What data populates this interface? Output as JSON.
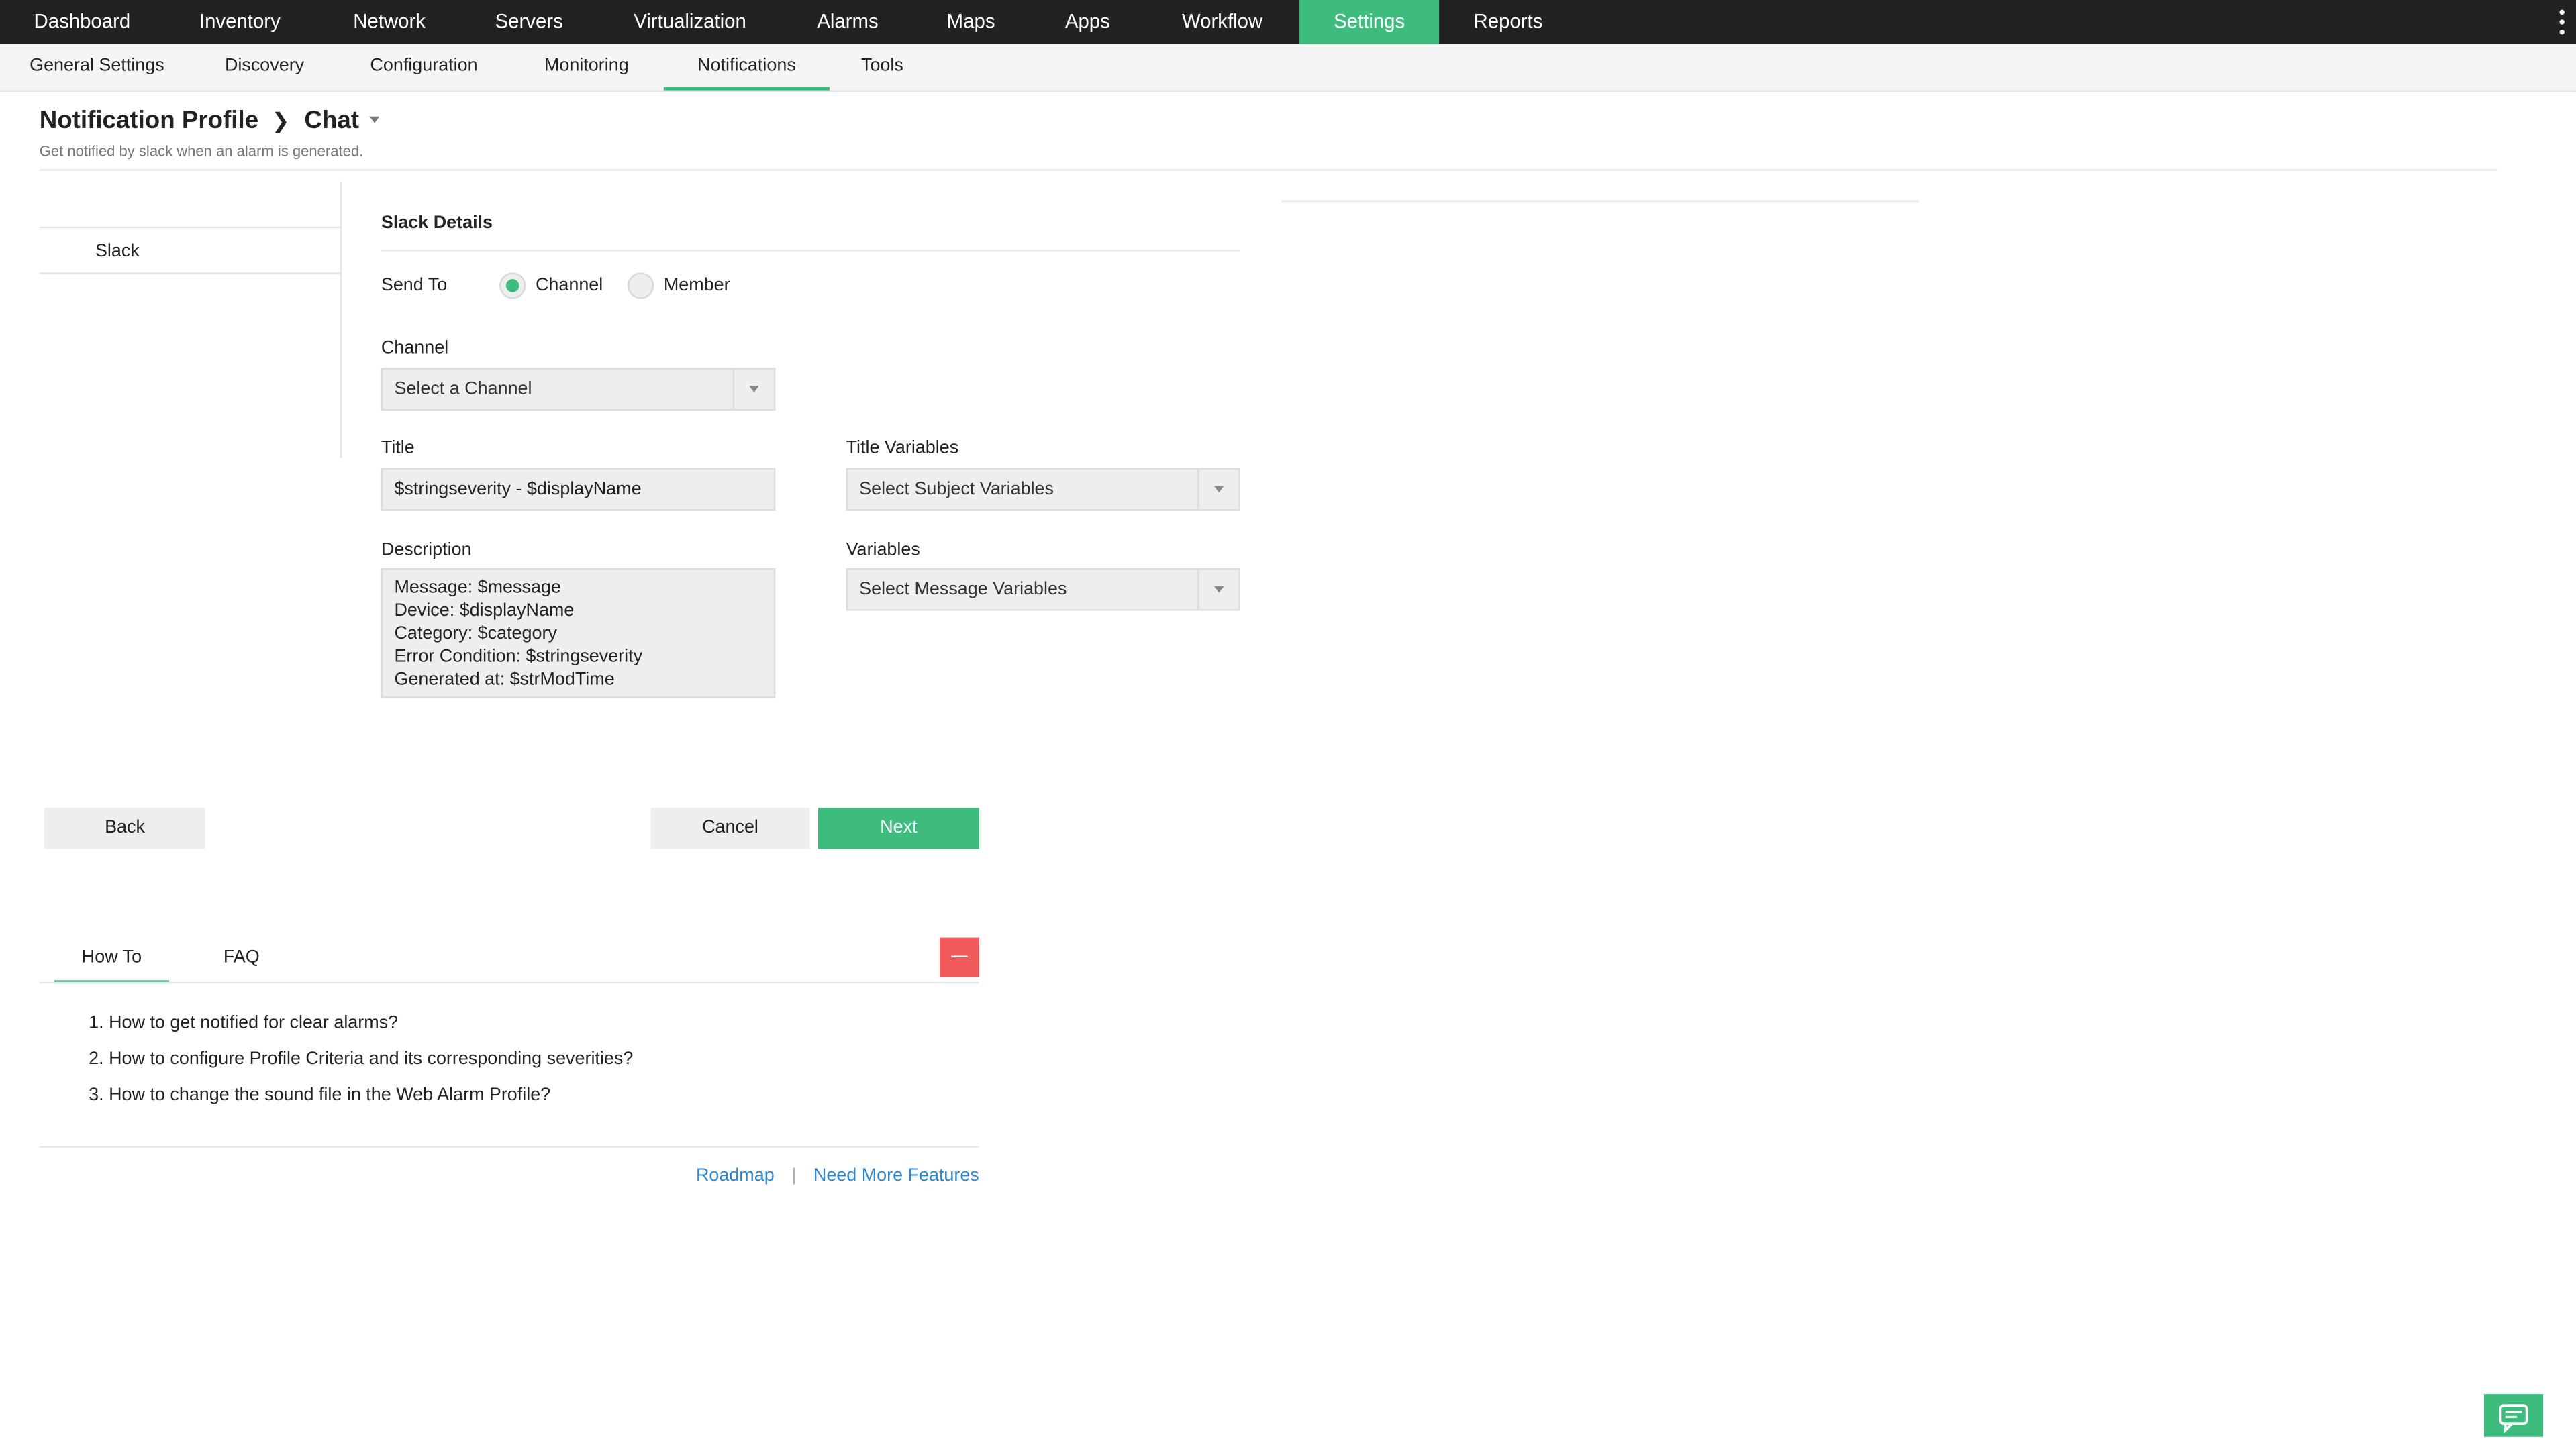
{
  "topnav": {
    "items": [
      {
        "label": "Dashboard"
      },
      {
        "label": "Inventory"
      },
      {
        "label": "Network"
      },
      {
        "label": "Servers"
      },
      {
        "label": "Virtualization"
      },
      {
        "label": "Alarms"
      },
      {
        "label": "Maps"
      },
      {
        "label": "Apps"
      },
      {
        "label": "Workflow"
      },
      {
        "label": "Settings"
      },
      {
        "label": "Reports"
      }
    ],
    "active": "Settings"
  },
  "subnav": {
    "items": [
      {
        "label": "General Settings"
      },
      {
        "label": "Discovery"
      },
      {
        "label": "Configuration"
      },
      {
        "label": "Monitoring"
      },
      {
        "label": "Notifications"
      },
      {
        "label": "Tools"
      }
    ],
    "active": "Notifications"
  },
  "header": {
    "breadcrumb_root": "Notification Profile",
    "breadcrumb_current": "Chat",
    "subtitle": "Get notified by slack when an alarm is generated."
  },
  "left_panel": {
    "tab": "Slack"
  },
  "form": {
    "section_title": "Slack Details",
    "send_to_label": "Send To",
    "radio_channel": "Channel",
    "radio_member": "Member",
    "selected_radio": "Channel",
    "channel_label": "Channel",
    "channel_placeholder": "Select a Channel",
    "title_label": "Title",
    "title_value": "$stringseverity - $displayName",
    "title_vars_label": "Title Variables",
    "title_vars_placeholder": "Select Subject Variables",
    "description_label": "Description",
    "description_lines": [
      "Message: $message",
      "Device: $displayName",
      "Category: $category",
      "Error Condition: $stringseverity",
      "Generated at: $strModTime"
    ],
    "variables_label": "Variables",
    "variables_placeholder": "Select Message Variables"
  },
  "buttons": {
    "back": "Back",
    "cancel": "Cancel",
    "next": "Next"
  },
  "help": {
    "tabs": [
      {
        "label": "How To"
      },
      {
        "label": "FAQ"
      }
    ],
    "active_tab": "How To",
    "items": [
      "1. How to get notified for clear alarms?",
      "2. How to configure Profile Criteria and its corresponding severities?",
      "3. How to change the sound file in the Web Alarm Profile?"
    ],
    "links": {
      "roadmap": "Roadmap",
      "separator": "|",
      "more": "Need More Features"
    }
  },
  "colors": {
    "accent": "#3ebc7e",
    "topbar": "#222222",
    "danger": "#f05a5a",
    "link": "#2d86d0"
  }
}
